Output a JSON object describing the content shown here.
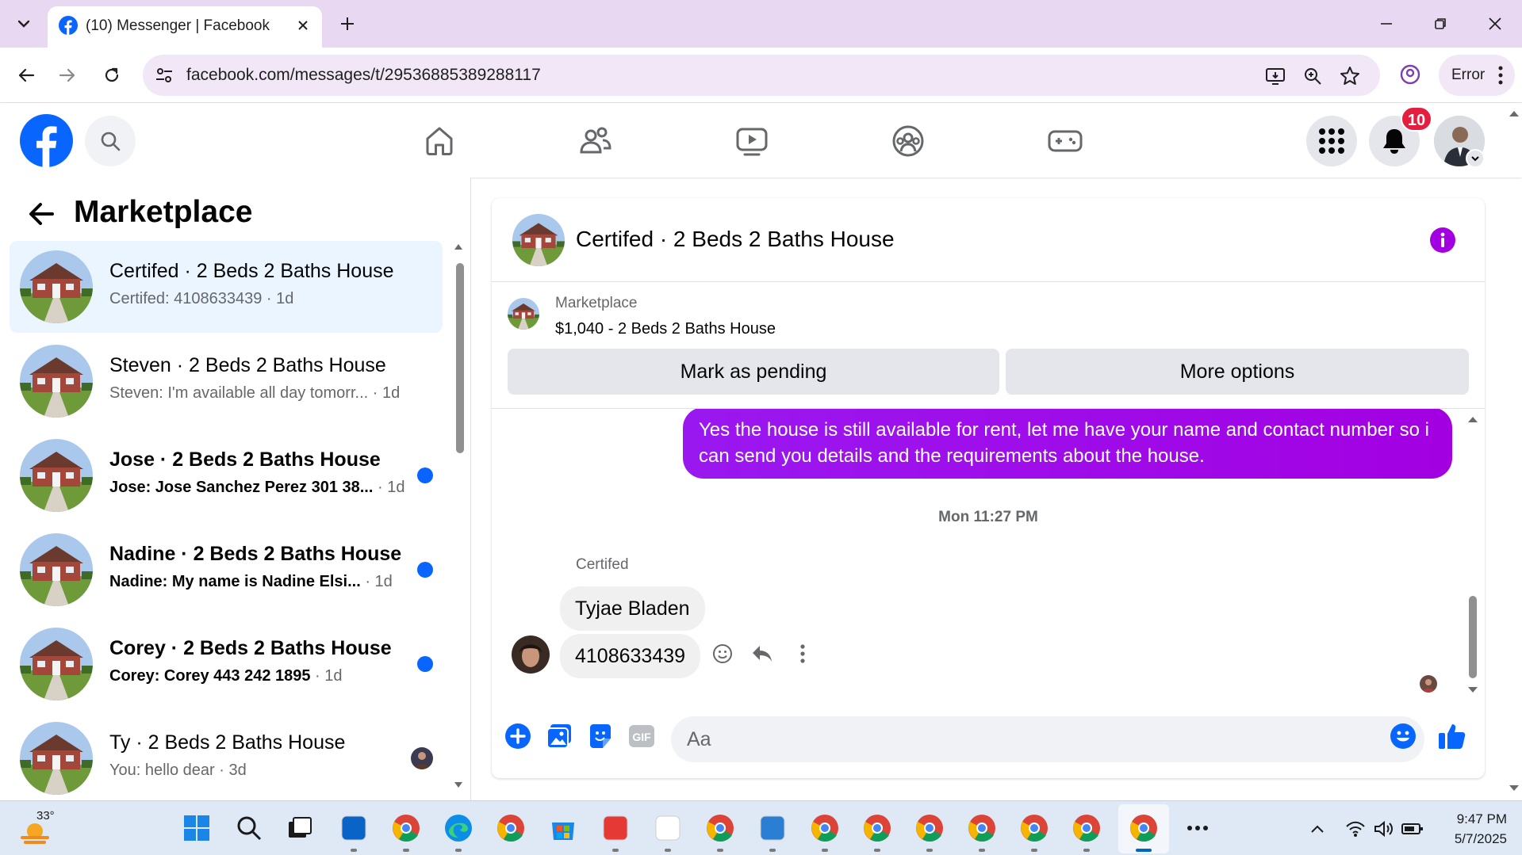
{
  "browser": {
    "tab_title": "(10) Messenger | Facebook",
    "url": "facebook.com/messages/t/29536885389288117",
    "error_label": "Error"
  },
  "fb_header": {
    "notification_count": "10"
  },
  "left_panel": {
    "title": "Marketplace",
    "conversations": [
      {
        "name": "Certifed · 2 Beds 2 Baths House",
        "preview": "Certifed: 4108633439",
        "time": " · 1d",
        "active": true,
        "unread": false
      },
      {
        "name": "Steven · 2 Beds 2 Baths House",
        "preview": "Steven: I'm available all day tomorr...",
        "time": " · 1d",
        "active": false,
        "unread": false
      },
      {
        "name": "Jose · 2 Beds 2 Baths House",
        "preview": "Jose: Jose Sanchez Perez 301 38...",
        "time": " · 1d",
        "active": false,
        "unread": true
      },
      {
        "name": "Nadine · 2 Beds 2 Baths House",
        "preview": "Nadine: My name is Nadine Elsi...",
        "time": " · 1d",
        "active": false,
        "unread": true
      },
      {
        "name": "Corey · 2 Beds 2 Baths House",
        "preview": "Corey: Corey 443 242 1895",
        "time": " · 1d",
        "active": false,
        "unread": true
      },
      {
        "name": "Ty · 2 Beds 2 Baths House",
        "preview": "You: hello dear",
        "time": " · 3d",
        "active": false,
        "unread": false
      }
    ]
  },
  "chat": {
    "title": "Certifed · 2 Beds 2 Baths House",
    "marketplace_label": "Marketplace",
    "listing": "$1,040 - 2 Beds 2 Baths House",
    "mark_pending_label": "Mark as pending",
    "more_options_label": "More options",
    "outgoing_message": "Yes the house is still available for rent, let me have your name and  contact number so i can send you details and the requirements about the house.",
    "timestamp": "Mon 11:27 PM",
    "sender_name": "Certifed",
    "incoming_messages": [
      "Tyjae Bladen",
      "4108633439"
    ],
    "composer_placeholder": "Aa"
  },
  "taskbar": {
    "temperature": "33°",
    "time": "9:47 PM",
    "date": "5/7/2025"
  },
  "colors": {
    "fb_blue": "#0866ff",
    "message_purple": "#a300e2",
    "badge_red": "#e41e3f",
    "active_row": "#ebf5ff"
  }
}
